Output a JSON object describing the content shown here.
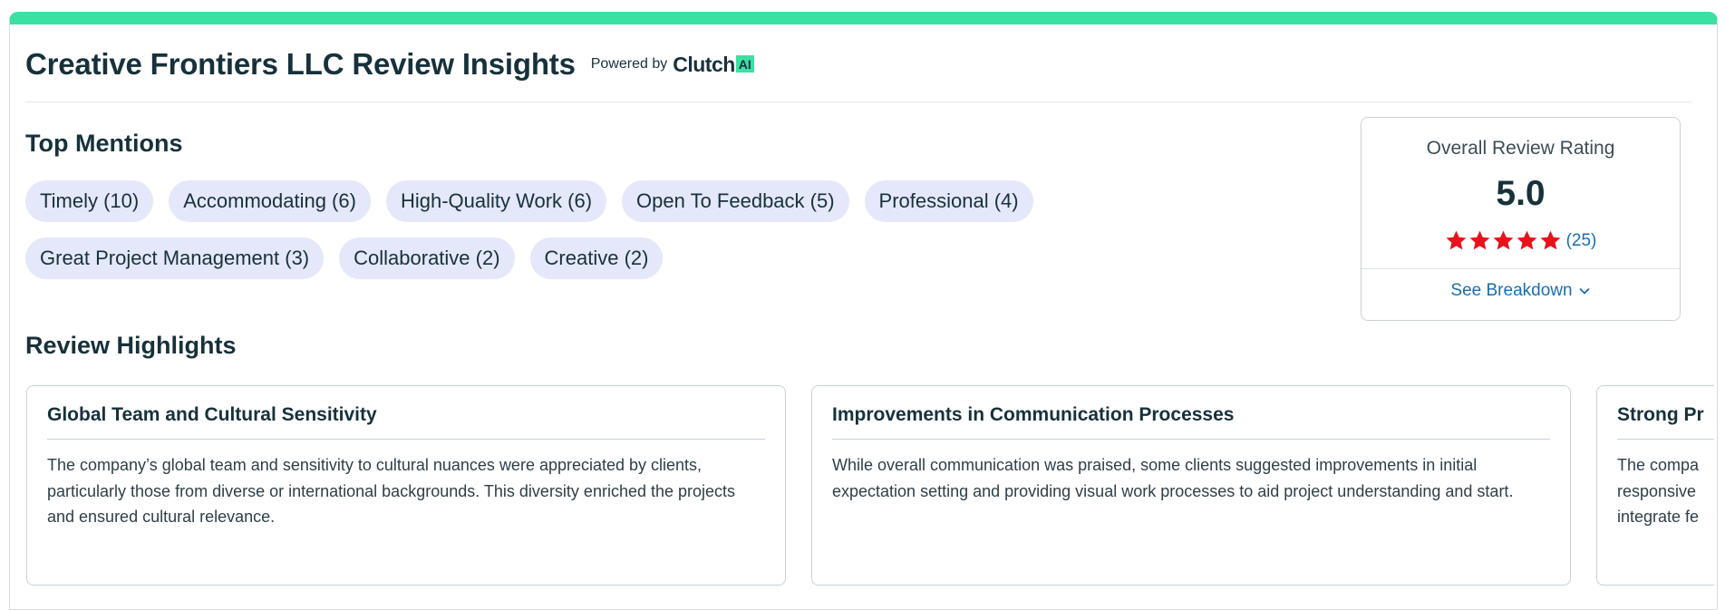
{
  "header": {
    "title": "Creative Frontiers LLC Review Insights",
    "powered_by": "Powered by",
    "brand": "Clutch",
    "brand_badge": "AI"
  },
  "top_mentions": {
    "title": "Top Mentions",
    "chips": [
      "Timely (10)",
      "Accommodating (6)",
      "High-Quality Work (6)",
      "Open To Feedback (5)",
      "Professional (4)",
      "Great Project Management (3)",
      "Collaborative (2)",
      "Creative (2)"
    ]
  },
  "rating": {
    "label": "Overall Review Rating",
    "value": "5.0",
    "stars": 5,
    "count": "(25)",
    "breakdown_label": "See Breakdown",
    "star_color": "#e8121b"
  },
  "highlights": {
    "title": "Review Highlights",
    "cards": [
      {
        "title": "Global Team and Cultural Sensitivity",
        "text": "The company’s global team and sensitivity to cultural nuances were appreciated by clients, particularly those from diverse or international backgrounds. This diversity enriched the projects and ensured cultural relevance."
      },
      {
        "title": "Improvements in Communication Processes",
        "text": "While overall communication was praised, some clients suggested improvements in initial expectation setting and providing visual work processes to aid project understanding and start."
      },
      {
        "title": "Strong Pr",
        "text": "The compa responsive integrate fe"
      }
    ]
  },
  "colors": {
    "accent": "#3be0a3",
    "chip_bg": "#e5e8fa",
    "link": "#1a6db0",
    "text": "#17313b"
  }
}
